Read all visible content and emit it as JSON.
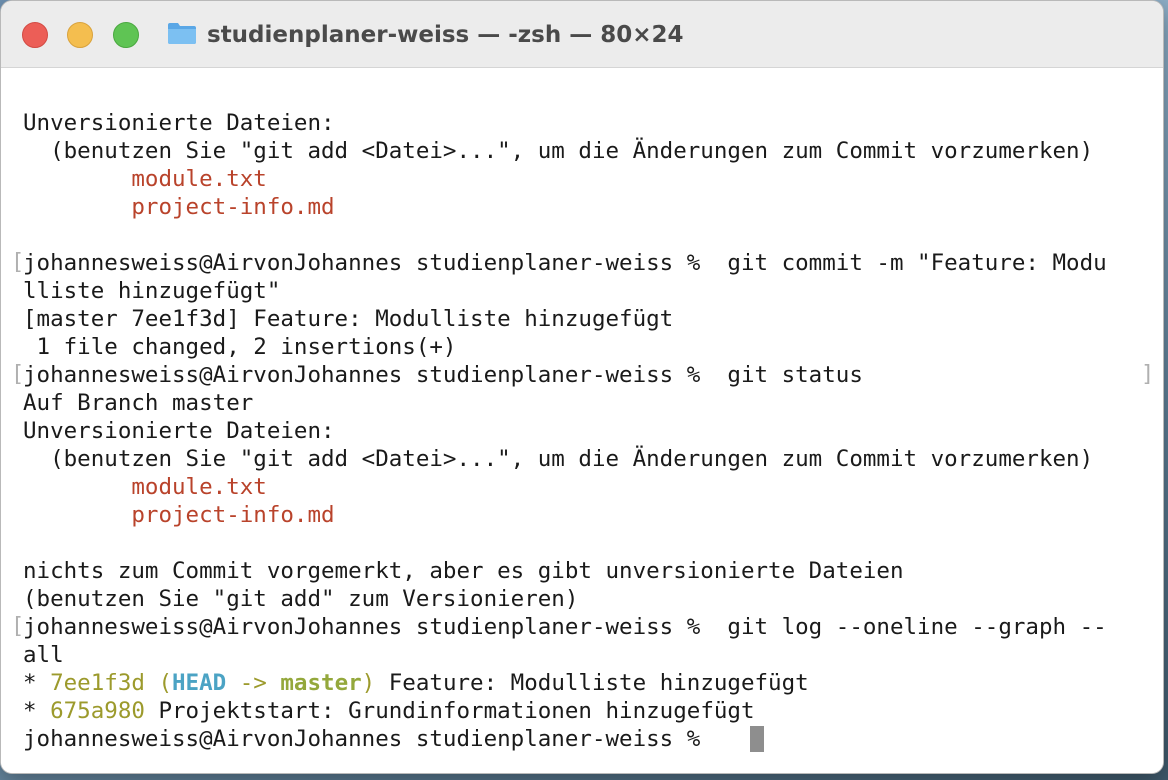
{
  "window": {
    "title": "studienplaner-weiss — -zsh — 80×24"
  },
  "terminal": {
    "lines": [
      {
        "text": "Unversionierte Dateien:"
      },
      {
        "text": "  (benutzen Sie \"git add <Datei>...\", um die Änderungen zum Commit vorzumerken)"
      },
      {
        "text": "        module.txt"
      },
      {
        "text": "        project-info.md"
      },
      {
        "text": ""
      },
      {
        "text": "johannesweiss@AirvonJohannes studienplaner-weiss %  git commit -m \"Feature: Modu"
      },
      {
        "text": "lliste hinzugefügt\""
      },
      {
        "text": "[master 7ee1f3d] Feature: Modulliste hinzugefügt"
      },
      {
        "text": " 1 file changed, 2 insertions(+)"
      },
      {
        "text": "johannesweiss@AirvonJohannes studienplaner-weiss %  git status"
      },
      {
        "text": "Auf Branch master"
      },
      {
        "text": "Unversionierte Dateien:"
      },
      {
        "text": "  (benutzen Sie \"git add <Datei>...\", um die Änderungen zum Commit vorzumerken)"
      },
      {
        "text": "        module.txt"
      },
      {
        "text": "        project-info.md"
      },
      {
        "text": ""
      },
      {
        "text": "nichts zum Commit vorgemerkt, aber es gibt unversionierte Dateien"
      },
      {
        "text": "(benutzen Sie \"git add\" zum Versionieren)"
      },
      {
        "text": "johannesweiss@AirvonJohannes studienplaner-weiss %  git log --oneline --graph --"
      },
      {
        "text": "all"
      }
    ],
    "log": [
      {
        "star": "* ",
        "hash": "7ee1f3d",
        "space": " ",
        "open": "(",
        "head": "HEAD",
        "arrow": " -> ",
        "branch": "master",
        "close": ")",
        "message": " Feature: Modulliste hinzugefügt"
      },
      {
        "star": "* ",
        "hash": "675a980",
        "message": " Projektstart: Grundinformationen hinzugefügt"
      }
    ],
    "prompt": "johannesweiss@AirvonJohannes studienplaner-weiss % ",
    "bracket_open": "[",
    "bracket_close": "]"
  },
  "colors": {
    "untracked_file": "#b9432b",
    "commit_hash": "#9c9a2c",
    "head": "#4ba3c4",
    "branch": "#94a83c"
  }
}
